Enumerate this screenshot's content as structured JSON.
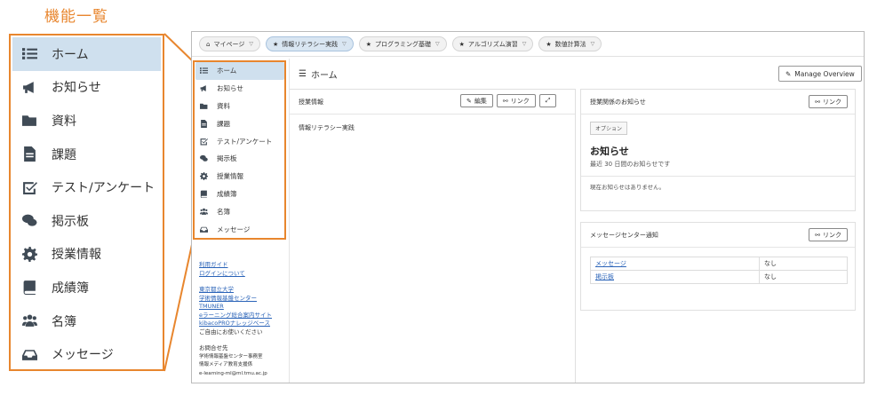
{
  "callout": {
    "title": "機能一覧"
  },
  "menu": [
    {
      "label": "ホーム",
      "icon": "list-icon",
      "active": true
    },
    {
      "label": "お知らせ",
      "icon": "megaphone-icon",
      "active": false
    },
    {
      "label": "資料",
      "icon": "folder-icon",
      "active": false
    },
    {
      "label": "課題",
      "icon": "file-icon",
      "active": false
    },
    {
      "label": "テスト/アンケート",
      "icon": "checkbox-icon",
      "active": false
    },
    {
      "label": "掲示板",
      "icon": "chat-icon",
      "active": false
    },
    {
      "label": "授業情報",
      "icon": "gear-icon",
      "active": false
    },
    {
      "label": "成績簿",
      "icon": "book-icon",
      "active": false
    },
    {
      "label": "名簿",
      "icon": "users-icon",
      "active": false
    },
    {
      "label": "メッセージ",
      "icon": "inbox-icon",
      "active": false
    }
  ],
  "topbar": {
    "crumbs": [
      {
        "label": "マイページ",
        "prefix": "⌂",
        "active": false
      },
      {
        "label": "情報リテラシー実践",
        "prefix": "★",
        "active": true
      },
      {
        "label": "プログラミング基礎",
        "prefix": "★",
        "active": false
      },
      {
        "label": "アルゴリズム演習",
        "prefix": "★",
        "active": false
      },
      {
        "label": "数値計算法",
        "prefix": "★",
        "active": false
      }
    ]
  },
  "sidebar": {
    "links": {
      "guide": "利用ガイド",
      "login": "ログインについて",
      "univ": "東京都立大学",
      "center": "学術情報基盤センター",
      "tmuner": "TMUNER",
      "elearning_guide": "eラーニング総合案内サイト",
      "kibaco": "kibacoPROナレッジベース"
    },
    "free_use": "ご自由にお使いください",
    "contact_title": "お問合せ先",
    "contact_line1": "学術情報基盤センター事務室",
    "contact_line2": "情報メディア教育支援係",
    "contact_email": "e-learning-ml@ml.tmu.ac.jp"
  },
  "main": {
    "page_title": "ホーム",
    "manage_label": "Manage Overview",
    "course_panel": {
      "title": "授業情報",
      "edit_label": "編集",
      "link_label": "リンク",
      "expand_icon": "expand-icon",
      "body": "情報リテラシー実践"
    },
    "notice_panel": {
      "title": "授業関係のお知らせ",
      "link_label": "リンク",
      "option_label": "オプション",
      "heading": "お知らせ",
      "sub": "最近 30 日間のお知らせです",
      "empty": "現在お知らせはありません。"
    },
    "message_panel": {
      "title": "メッセージセンター通知",
      "link_label": "リンク",
      "rows": [
        {
          "name": "メッセージ",
          "value": "なし"
        },
        {
          "name": "掲示板",
          "value": "なし"
        }
      ]
    }
  },
  "colors": {
    "accent": "#e8862e",
    "active_bg": "#cfe0ee",
    "link": "#2a63b8"
  }
}
